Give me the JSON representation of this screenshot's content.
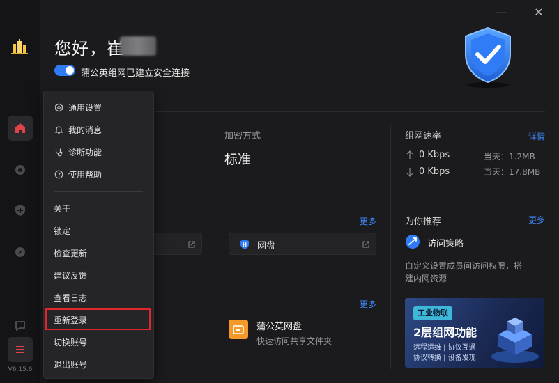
{
  "window": {
    "minimize_glyph": "—",
    "close_glyph": "✕"
  },
  "rail": {
    "version": "V6.15.6",
    "items": [
      {
        "icon": "home-icon",
        "active": true
      },
      {
        "icon": "network-icon",
        "active": false
      },
      {
        "icon": "shield-plus-icon",
        "active": false
      },
      {
        "icon": "compass-icon",
        "active": false
      },
      {
        "icon": "chat-icon",
        "active": false
      },
      {
        "icon": "menu-icon",
        "active": false
      }
    ],
    "accent": "#e2434b"
  },
  "header": {
    "greeting": "您好，崔",
    "connection_status": "蒲公英组网已建立安全连接"
  },
  "main": {
    "encryption_label": "加密方式",
    "encryption_value": "标准",
    "more_1": "更多",
    "more_2": "更多",
    "netdisk_card_label": "网盘",
    "netdisk_app_title": "蒲公英网盘",
    "netdisk_app_desc": "快速访问共享文件夹"
  },
  "speed": {
    "title": "组网速率",
    "details": "详情",
    "up": "0 Kbps",
    "down": "0 Kbps",
    "today_up": "当天：1.2MB",
    "today_down": "当天：17.8MB"
  },
  "recommend": {
    "title": "为你推荐",
    "more": "更多",
    "item_label": "访问策略",
    "item_desc_1": "自定义设置成员间访问权限，搭",
    "item_desc_2": "建内网资源"
  },
  "banner": {
    "tag": "工业物联",
    "title": "2层组网功能",
    "line1": "远程运维 | 协议互通",
    "line2": "协议转换 | 设备发现"
  },
  "menu": {
    "top_items": [
      {
        "label": "通用设置",
        "icon": "settings-icon"
      },
      {
        "label": "我的消息",
        "icon": "bell-icon"
      },
      {
        "label": "诊断功能",
        "icon": "stethoscope-icon"
      },
      {
        "label": "使用帮助",
        "icon": "help-icon"
      }
    ],
    "items": [
      "关于",
      "锁定",
      "检查更新",
      "建议反馈",
      "查看日志",
      "重新登录",
      "切换账号",
      "退出账号"
    ],
    "highlighted": "重新登录",
    "highlight_color": "#e0262b"
  }
}
